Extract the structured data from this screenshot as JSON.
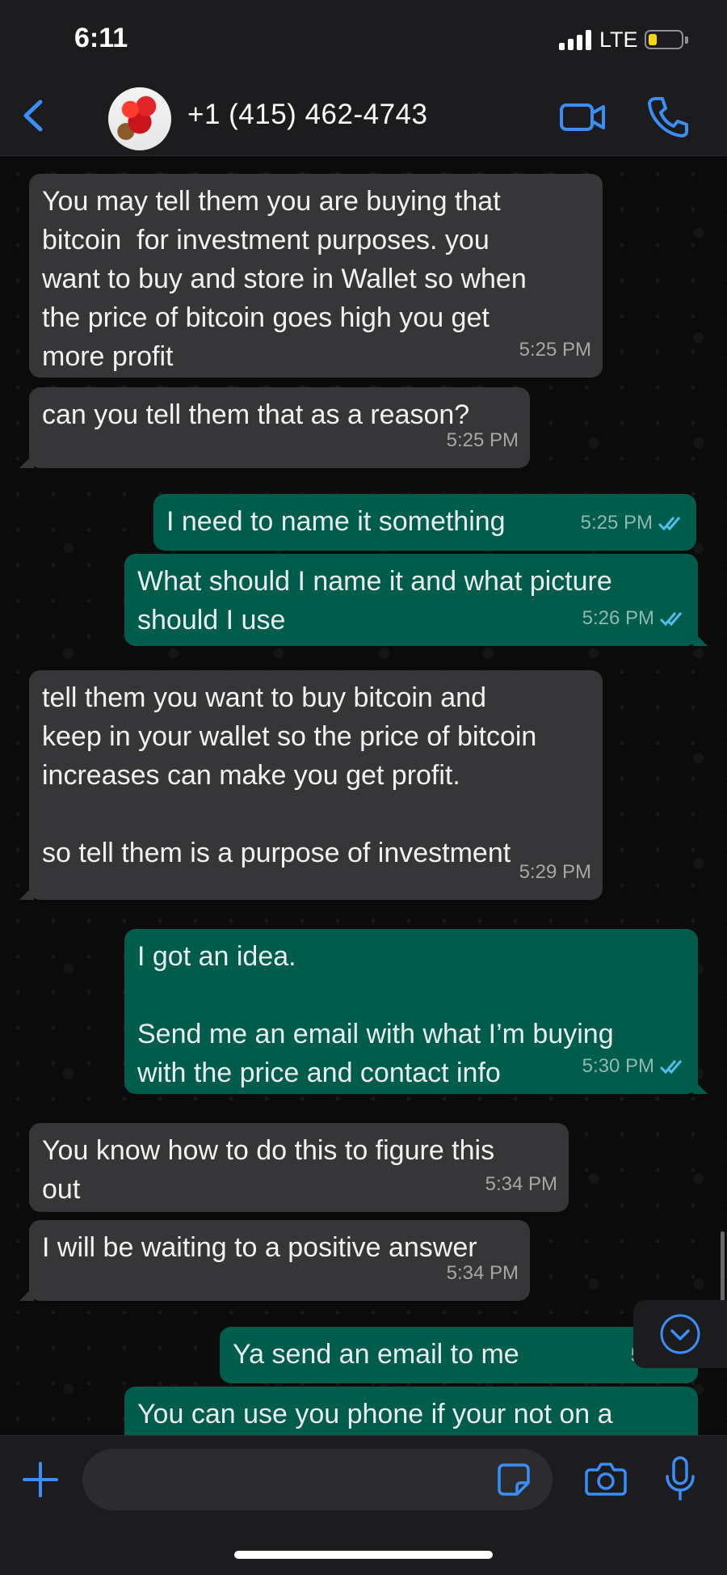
{
  "status_bar": {
    "time": "6:11",
    "network": "LTE",
    "battery_color": "#ffd60a"
  },
  "header": {
    "contact_name": "+1 (415) 462-4743",
    "accent_color": "#3a8ef6"
  },
  "messages": [
    {
      "direction": "in",
      "text": "You may tell them you are buying that\nbitcoin  for investment purposes. you\nwant to buy and store in Wallet so when\nthe price of bitcoin goes high you get\nmore profit",
      "time": "5:25 PM"
    },
    {
      "direction": "in",
      "text": "can you tell them that as a reason?",
      "time": "5:25 PM"
    },
    {
      "direction": "out",
      "text": "I need to name it something",
      "time": "5:25 PM",
      "status": "read"
    },
    {
      "direction": "out",
      "text": "What should I name it and what picture\nshould I use",
      "time": "5:26 PM",
      "status": "read"
    },
    {
      "direction": "in",
      "text": "tell them you want to buy bitcoin and\nkeep in your wallet so the price of bitcoin\nincreases can make you get profit.\n\nso tell them is a purpose of investment",
      "time": "5:29 PM"
    },
    {
      "direction": "out",
      "text": "I got an idea.\n\nSend me an email with what I’m buying\nwith the price and contact info",
      "time": "5:30 PM",
      "status": "read"
    },
    {
      "direction": "in",
      "text": "You know how to do this to figure this\nout",
      "time": "5:34 PM"
    },
    {
      "direction": "in",
      "text": "I will be waiting to a positive answer",
      "time": "5:34 PM"
    },
    {
      "direction": "out",
      "text": "Ya send an email to me",
      "time": "5:35 P",
      "status": "read"
    },
    {
      "direction": "out",
      "text": "You can use you phone if your not on a",
      "time": "",
      "status": ""
    }
  ],
  "colors": {
    "incoming_bubble": "#363638",
    "outgoing_bubble": "#005c4b",
    "read_ticks": "#53bdeb"
  },
  "icons": [
    "back-icon",
    "video-call-icon",
    "voice-call-icon",
    "scroll-down-icon",
    "plus-icon",
    "sticker-icon",
    "camera-icon",
    "microphone-icon"
  ]
}
